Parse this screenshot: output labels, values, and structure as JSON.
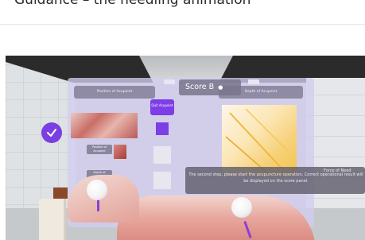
{
  "caption": {
    "text": "Guidance – the needling animation"
  },
  "vr": {
    "score": "Score B",
    "position_header": "Position of Acupoint",
    "depth_header": "Depth of Acupoint",
    "quit_label": "Quit Acupoint",
    "message": "The second step, please start the acupuncture operation. Correct operational result will be displayed on the score panel.",
    "force_header": "Force of Need",
    "chips": [
      "Position of Acupoint",
      "Depth of Acupoint"
    ],
    "icons": {
      "confirm": "check-icon",
      "score_dropdown": "chevron-down-icon"
    },
    "colors": {
      "accent": "#7d3ee6",
      "panel": "#d2cdf0"
    }
  }
}
